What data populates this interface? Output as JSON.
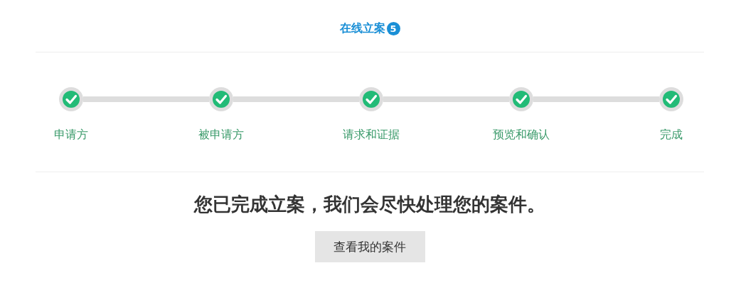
{
  "header": {
    "title": "在线立案",
    "badge": "5"
  },
  "steps": [
    {
      "label": "申请方",
      "done": true
    },
    {
      "label": "被申请方",
      "done": true
    },
    {
      "label": "请求和证据",
      "done": true
    },
    {
      "label": "预览和确认",
      "done": true
    },
    {
      "label": "完成",
      "done": true
    }
  ],
  "message": "您已完成立案，我们会尽快处理您的案件。",
  "button": "查看我的案件"
}
